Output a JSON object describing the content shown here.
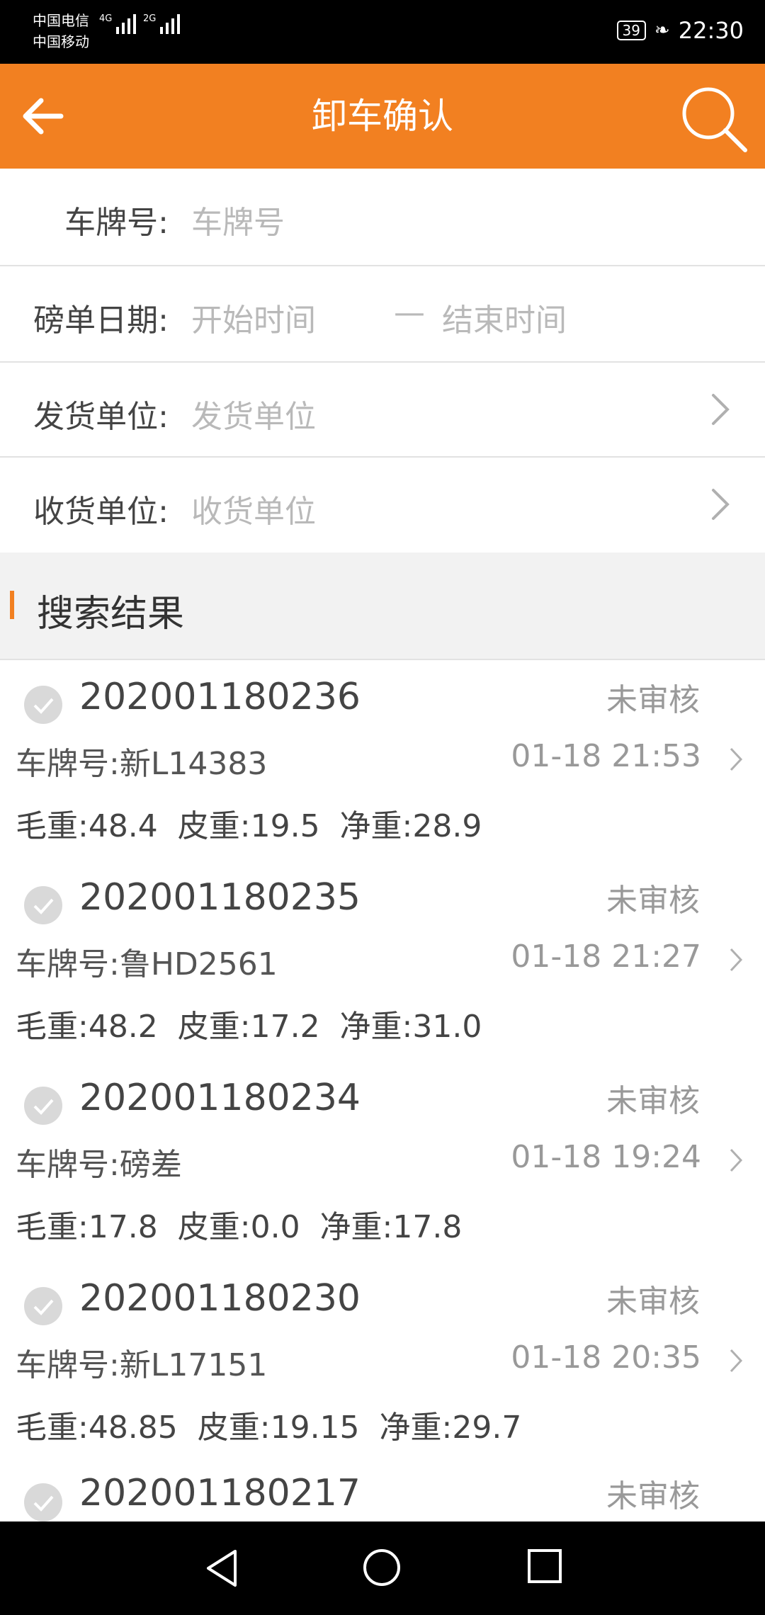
{
  "status_bar": {
    "carrier1": "中国电信",
    "carrier2": "中国移动",
    "net1": "4G",
    "net2": "2G",
    "battery": "39",
    "time": "22:30"
  },
  "header": {
    "title": "卸车确认",
    "back_icon": "arrow-left-icon",
    "search_icon": "search-icon",
    "color": "#f28021"
  },
  "filters": {
    "plate_label": "车牌号:",
    "plate_placeholder": "车牌号",
    "date_label": "磅单日期:",
    "start_placeholder": "开始时间",
    "date_separator": "—",
    "end_placeholder": "结束时间",
    "sender_label": "发货单位:",
    "sender_placeholder": "发货单位",
    "receiver_label": "收货单位:",
    "receiver_placeholder": "收货单位"
  },
  "results": {
    "title": "搜索结果",
    "records": [
      {
        "id": "202001180236",
        "status": "未审核",
        "plate": "车牌号:新L14383",
        "time": "01-18 21:53",
        "weights": "毛重:48.4  皮重:19.5  净重:28.9"
      },
      {
        "id": "202001180235",
        "status": "未审核",
        "plate": "车牌号:鲁HD2561",
        "time": "01-18 21:27",
        "weights": "毛重:48.2  皮重:17.2  净重:31.0"
      },
      {
        "id": "202001180234",
        "status": "未审核",
        "plate": "车牌号:磅差",
        "time": "01-18 19:24",
        "weights": "毛重:17.8  皮重:0.0  净重:17.8"
      },
      {
        "id": "202001180230",
        "status": "未审核",
        "plate": "车牌号:新L17151",
        "time": "01-18 20:35",
        "weights": "毛重:48.85  皮重:19.15  净重:29.7"
      },
      {
        "id": "202001180217",
        "status": "未审核",
        "plate": "",
        "time": "",
        "weights": ""
      }
    ]
  }
}
